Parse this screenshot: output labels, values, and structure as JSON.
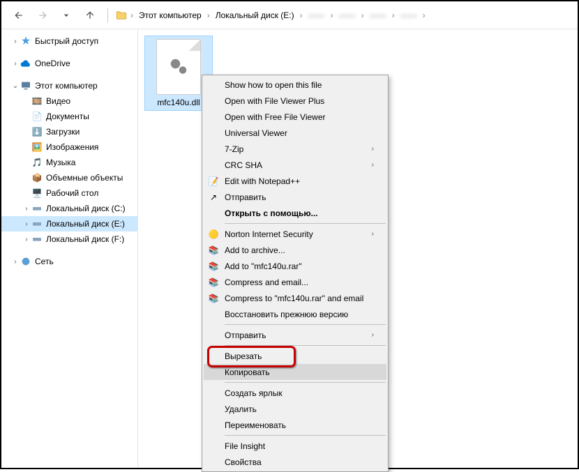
{
  "toolbar": {
    "crumbs": [
      "Этот компьютер",
      "Локальный диск (E:)"
    ],
    "blur_crumbs": [
      "——",
      "——",
      "——",
      "——"
    ]
  },
  "nav": {
    "quick": "Быстрый доступ",
    "onedrive": "OneDrive",
    "pc": "Этот компьютер",
    "video": "Видео",
    "docs": "Документы",
    "downloads": "Загрузки",
    "images": "Изображения",
    "music": "Музыка",
    "volumes": "Объемные объекты",
    "desktop": "Рабочий стол",
    "drive_c": "Локальный диск (C:)",
    "drive_e": "Локальный диск (E:)",
    "drive_f": "Локальный диск (F:)",
    "network": "Сеть"
  },
  "file": {
    "name": "mfc140u.dll"
  },
  "ctx": {
    "show_open": "Show how to open this file",
    "open_fvp": "Open with File Viewer Plus",
    "open_ffv": "Open with Free File Viewer",
    "uv": "Universal Viewer",
    "sevenzip": "7-Zip",
    "crc": "CRC SHA",
    "notepadpp": "Edit with Notepad++",
    "send1": "Отправить",
    "open_with": "Открыть с помощью...",
    "norton": "Norton Internet Security",
    "rar_add": "Add to archive...",
    "rar_addname": "Add to \"mfc140u.rar\"",
    "rar_comp": "Compress and email...",
    "rar_compname": "Compress to \"mfc140u.rar\" and email",
    "restore": "Восстановить прежнюю версию",
    "send2": "Отправить",
    "cut": "Вырезать",
    "copy": "Копировать",
    "shortcut": "Создать ярлык",
    "delete": "Удалить",
    "rename": "Переименовать",
    "fileinsight": "File Insight",
    "props": "Свойства"
  }
}
